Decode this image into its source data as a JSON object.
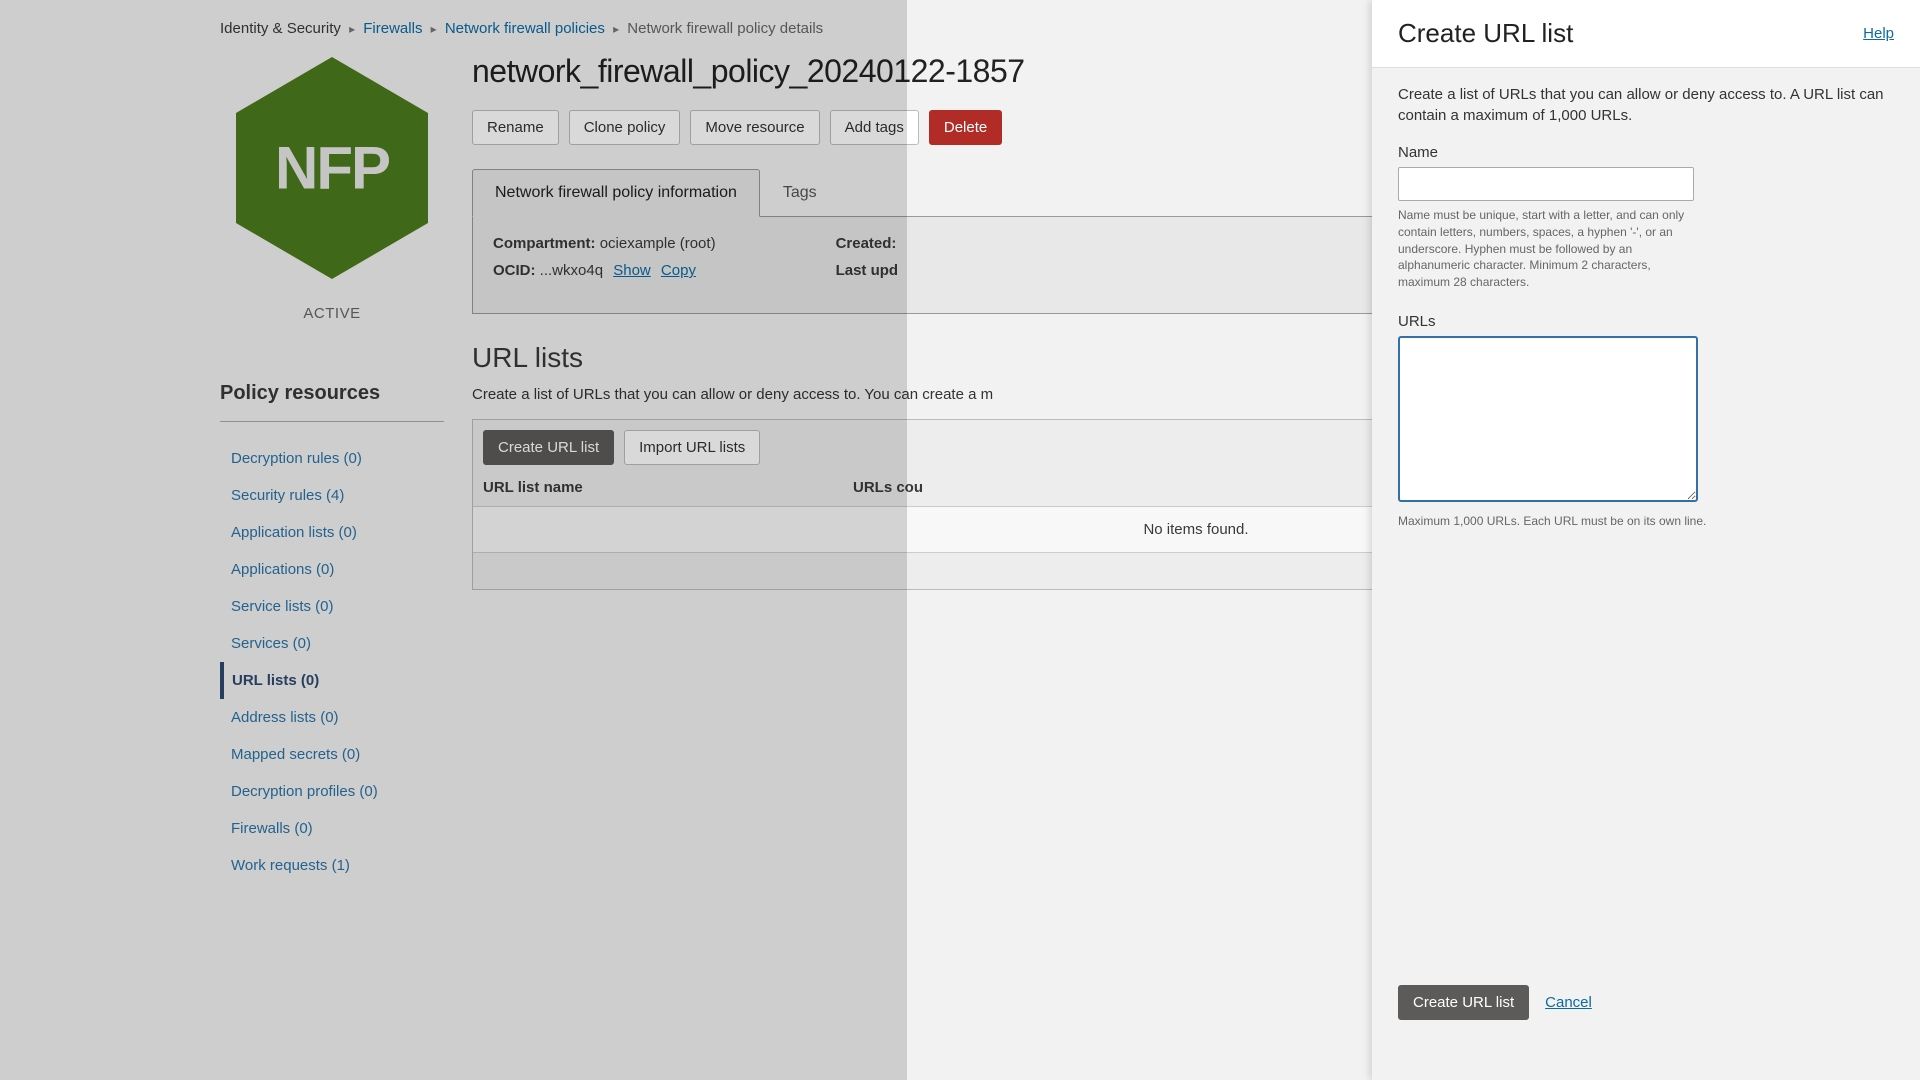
{
  "breadcrumbs": {
    "root": "Identity & Security",
    "l1": "Firewalls",
    "l2": "Network firewall policies",
    "current": "Network firewall policy details"
  },
  "left": {
    "hex_label": "NFP",
    "status": "ACTIVE",
    "resources_heading": "Policy resources",
    "items": [
      {
        "label": "Decryption rules (0)"
      },
      {
        "label": "Security rules (4)"
      },
      {
        "label": "Application lists (0)"
      },
      {
        "label": "Applications (0)"
      },
      {
        "label": "Service lists (0)"
      },
      {
        "label": "Services (0)"
      },
      {
        "label": "URL lists (0)"
      },
      {
        "label": "Address lists (0)"
      },
      {
        "label": "Mapped secrets (0)"
      },
      {
        "label": "Decryption profiles (0)"
      },
      {
        "label": "Firewalls (0)"
      },
      {
        "label": "Work requests (1)"
      }
    ]
  },
  "main": {
    "title": "network_firewall_policy_20240122-1857",
    "actions": {
      "rename": "Rename",
      "clone": "Clone policy",
      "move": "Move resource",
      "add_tags": "Add tags",
      "delete": "Delete"
    },
    "tabs": {
      "info": "Network firewall policy information",
      "tags": "Tags"
    },
    "info": {
      "compartment_k": "Compartment:",
      "compartment_v": "ociexample (root)",
      "ocid_k": "OCID:",
      "ocid_v": "...wkxo4q",
      "show": "Show",
      "copy": "Copy",
      "created_k": "Created:",
      "updated_k": "Last upd"
    },
    "url_section": {
      "title": "URL lists",
      "desc": "Create a list of URLs that you can allow or deny access to. You can create a m",
      "create_btn": "Create URL list",
      "import_btn": "Import URL lists",
      "th_name": "URL list name",
      "th_count": "URLs cou",
      "no_items": "No items found."
    }
  },
  "panel": {
    "title": "Create URL list",
    "help": "Help",
    "desc": "Create a list of URLs that you can allow or deny access to. A URL list can contain a maximum of 1,000 URLs.",
    "name_label": "Name",
    "name_hint": "Name must be unique, start with a letter, and can only contain letters, numbers, spaces, a hyphen '-', or an underscore. Hyphen must be followed by an alphanumeric character. Minimum 2 characters, maximum 28 characters.",
    "urls_label": "URLs",
    "urls_hint": "Maximum 1,000 URLs. Each URL must be on its own line.",
    "submit": "Create URL list",
    "cancel": "Cancel"
  }
}
